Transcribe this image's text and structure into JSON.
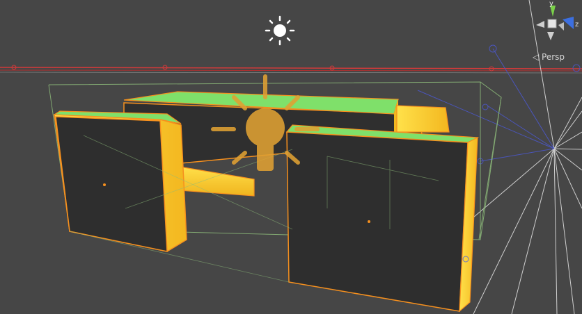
{
  "view": {
    "projection_label": "◁ Persp",
    "axes": {
      "y": "y",
      "z": "z"
    }
  },
  "icons": {
    "sun": "directional-light-icon",
    "bulb": "point-light-icon",
    "gizmo": "scene-orientation-gizmo"
  },
  "colors": {
    "background": "#464646",
    "selection_outline": "#f6901e",
    "top_face": "#7fe06a",
    "side_face": "#ffd035",
    "front_face": "#2e2e2e",
    "bounds": "#8dbb7a",
    "x_axis": "#e03c3c",
    "y_axis": "#7bd14a",
    "z_axis": "#3c6fe0",
    "bulb": "#e0a133"
  }
}
